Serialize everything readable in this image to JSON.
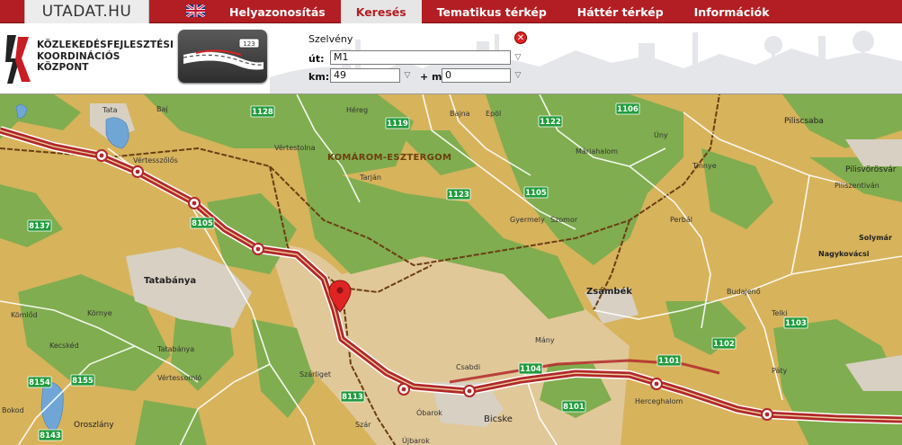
{
  "brand": {
    "title": "UTADAT.HU"
  },
  "language_flag": "uk-flag-icon",
  "nav": {
    "items": [
      {
        "label": "Helyazonosítás",
        "active": false
      },
      {
        "label": "Keresés",
        "active": true
      },
      {
        "label": "Tematikus térkép",
        "active": false
      },
      {
        "label": "Háttér térkép",
        "active": false
      },
      {
        "label": "Információk",
        "active": false
      }
    ]
  },
  "logo": {
    "icon": "kkk-logo-icon",
    "lines": [
      "KÖZLEKEDÉSFEJLESZTÉSI",
      "KOORDINÁCIÓS",
      "KÖZPONT"
    ]
  },
  "road_thumb": {
    "sign": "123"
  },
  "search": {
    "title": "Szelvény",
    "road_label": "út:",
    "road_value": "M1",
    "km_label": "km:",
    "km_value": "49",
    "m_label": "+ m:",
    "m_value": "0",
    "close_icon": "close-icon"
  },
  "map": {
    "county_label": "KOMÁROM-ESZTERGOM",
    "cities": [
      "Tatabánya",
      "Zsámbék"
    ],
    "towns": [
      "Tata",
      "Baj",
      "Vértesszőlős",
      "Vértestolna",
      "Héreg",
      "Bajna",
      "Epöl",
      "Tarján",
      "Máriahalom",
      "Úny",
      "Tinnye",
      "Piliscsaba",
      "Pilisvörösvár",
      "Piliszentiván",
      "Solymár",
      "Nagykovácsi",
      "Perbál",
      "Gyermely",
      "Szomor",
      "Kömlőd",
      "Környe",
      "Kecskéd",
      "Tatabánya",
      "Budajenő",
      "Telki",
      "Mány",
      "Csabdi",
      "Szárliget",
      "Vértessomló",
      "Oroszlány",
      "Bokod",
      "Szár",
      "Óbarok",
      "Bicske",
      "Herceghalom",
      "Páty",
      "Újbarok"
    ],
    "road_shields": [
      "1128",
      "1119",
      "1122",
      "1106",
      "1123",
      "1105",
      "8105",
      "8137",
      "8154",
      "8155",
      "8113",
      "1104",
      "1101",
      "1102",
      "1103",
      "8101",
      "8143"
    ],
    "motorway": "M1",
    "marker_icon": "location-pin-icon",
    "colors": {
      "forest": "#7fae4e",
      "farmland": "#d8b45a",
      "urban": "#d6cfc0",
      "motorway": "#b2282a",
      "border": "#6a3e14",
      "water": "#6fa6d6"
    }
  }
}
